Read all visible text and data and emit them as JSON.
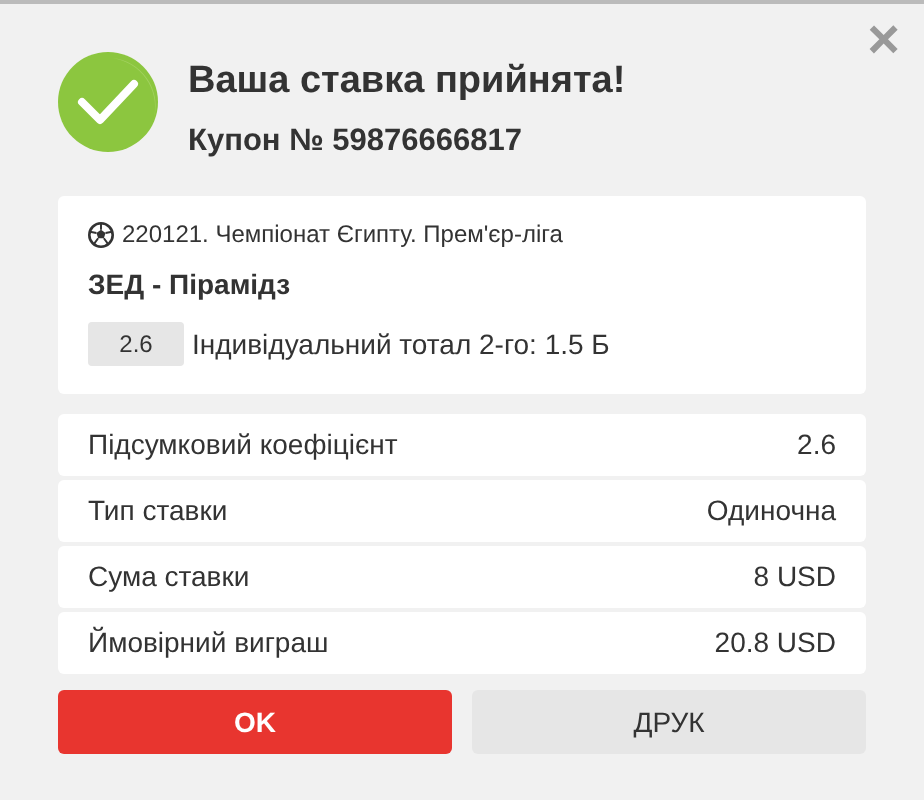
{
  "close_button": "×",
  "header": {
    "title": "Ваша ставка прийнята!",
    "coupon": "Купон № 59876666817"
  },
  "event": {
    "league": "220121. Чемпіонат Єгипту. Прем'єр-ліга",
    "match": "ЗЕД - Пірамідз",
    "odds": "2.6",
    "market": "Індивідуальний тотал 2-го: 1.5 Б"
  },
  "summary": [
    {
      "label": "Підсумковий коефіцієнт",
      "value": "2.6"
    },
    {
      "label": "Тип ставки",
      "value": "Одиночна"
    },
    {
      "label": "Сума ставки",
      "value": "8 USD"
    },
    {
      "label": "Ймовірний виграш",
      "value": "20.8 USD"
    }
  ],
  "buttons": [
    {
      "label": "OK",
      "kind": "primary"
    },
    {
      "label": "ДРУК",
      "kind": "secondary"
    }
  ]
}
